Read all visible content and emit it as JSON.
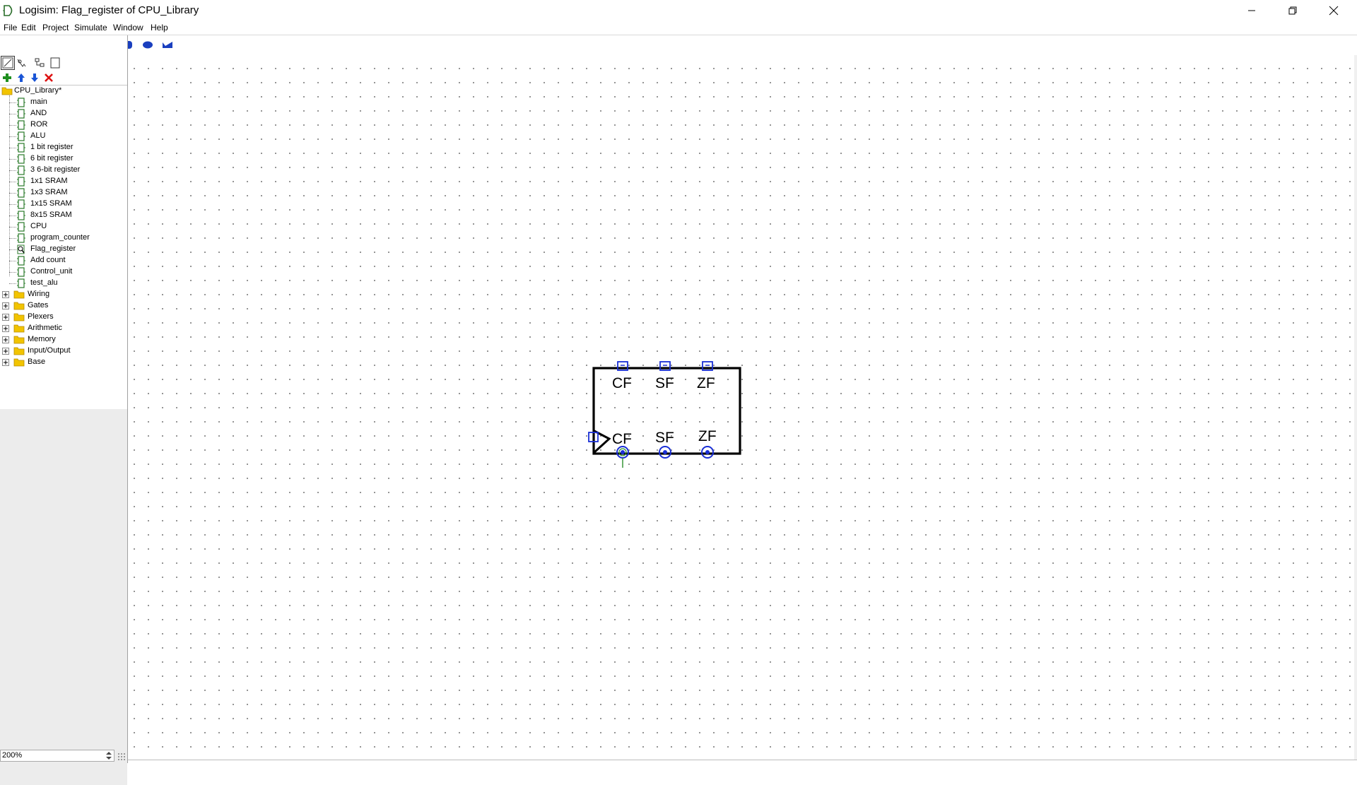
{
  "window": {
    "title": "Logisim: Flag_register of CPU_Library"
  },
  "menubar": {
    "items": [
      "File",
      "Edit",
      "Project",
      "Simulate",
      "Window",
      "Help"
    ]
  },
  "tools": [
    "select-tool",
    "text-tool",
    "line-tool",
    "curve-tool",
    "polyline-tool",
    "rectangle-tool",
    "rounded-rectangle-tool",
    "oval-tool",
    "polygon-tool"
  ],
  "project_tree": {
    "root": "CPU_Library*",
    "circuits": [
      "main",
      "AND",
      "ROR",
      "ALU",
      "1 bit register",
      "6 bit register",
      "3 6-bit register",
      "1x1 SRAM",
      "1x3 SRAM",
      "1x15 SRAM",
      "8x15 SRAM",
      "CPU",
      "program_counter",
      "Flag_register",
      "Add count",
      "Control_unit",
      "test_alu"
    ],
    "active_circuit": "Flag_register",
    "libraries": [
      "Wiring",
      "Gates",
      "Plexers",
      "Arithmetic",
      "Memory",
      "Input/Output",
      "Base"
    ]
  },
  "zoom": {
    "value": "200%"
  },
  "circuit": {
    "top_pins": [
      "CF",
      "SF",
      "ZF"
    ],
    "bottom_pins": [
      "CF",
      "SF",
      "ZF"
    ]
  },
  "colors": {
    "pin_blue": "#0000cc",
    "wire_green": "#008000",
    "accent_folder": "#f2c400"
  }
}
